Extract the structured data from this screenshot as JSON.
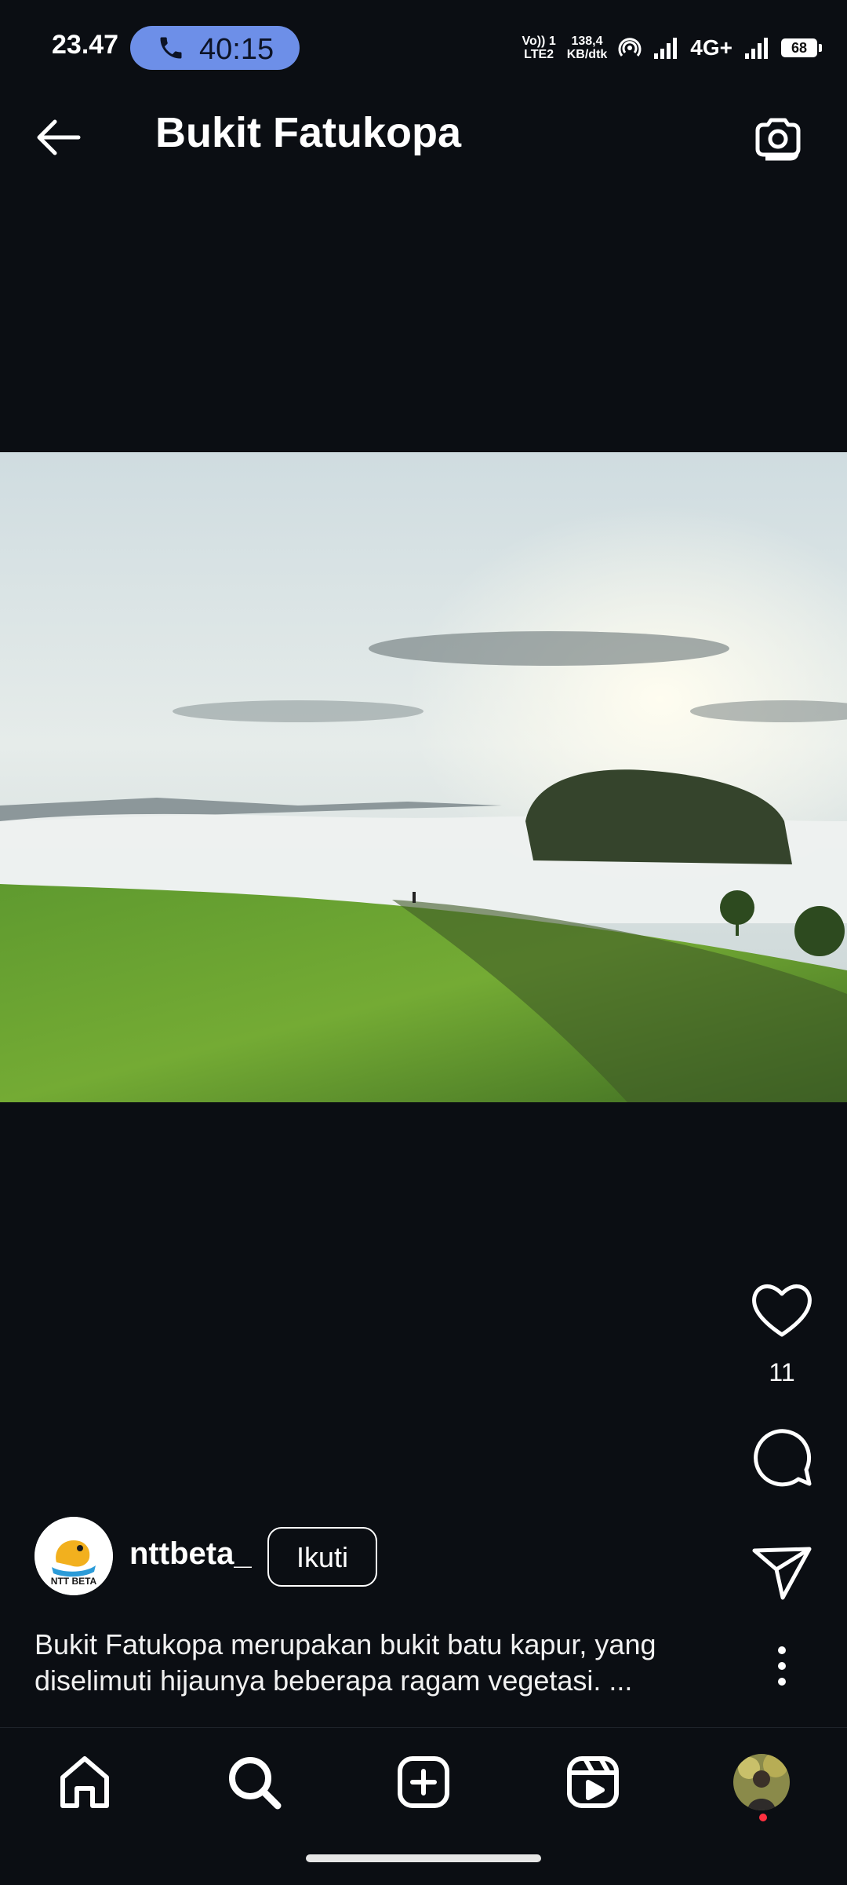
{
  "status_bar": {
    "time": "23.47",
    "call_duration": "40:15",
    "volte_line1": "Vo)) 1",
    "volte_line2": "LTE2",
    "speed_value": "138,4",
    "speed_unit": "KB/dtk",
    "network_type": "4G+",
    "battery": "68"
  },
  "header": {
    "title": "Bukit Fatukopa",
    "back_icon": "arrow-left-icon",
    "camera_icon": "camera-icon"
  },
  "post": {
    "like_count": "11",
    "author": "nttbeta_",
    "avatar_text": "NTT BETA",
    "follow_label": "Ikuti",
    "caption": "Bukit Fatukopa merupakan bukit batu kapur, yang diselimuti hijaunya beberapa ragam vegetasi. ..."
  },
  "actions": {
    "like_icon": "heart-icon",
    "comment_icon": "comment-icon",
    "share_icon": "send-icon",
    "more_icon": "more-vertical-icon"
  },
  "bottom_nav": {
    "items": [
      "home-icon",
      "search-icon",
      "create-icon",
      "reels-icon",
      "profile-avatar"
    ]
  },
  "colors": {
    "background": "#0b0e13",
    "call_pill": "#6d8fe8",
    "notification_dot": "#ff3040"
  }
}
